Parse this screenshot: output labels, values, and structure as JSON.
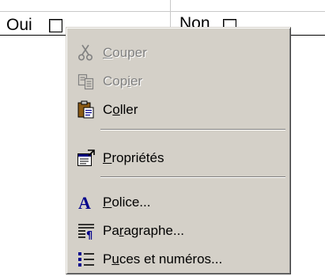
{
  "document": {
    "oui_label": "Oui",
    "non_label": "Non"
  },
  "menu": {
    "items": [
      {
        "label": "Couper",
        "access_key_index": 0,
        "icon": "scissors-icon",
        "enabled": false
      },
      {
        "label": "Copier",
        "access_key_index": 3,
        "icon": "copy-icon",
        "enabled": false
      },
      {
        "label": "Coller",
        "access_key_index": 1,
        "icon": "paste-icon",
        "enabled": true
      },
      {
        "label": "Propriétés",
        "access_key_index": 0,
        "icon": "properties-icon",
        "enabled": true
      },
      {
        "label": "Police...",
        "access_key_index": 0,
        "icon": "font-icon",
        "enabled": true
      },
      {
        "label": "Paragraphe...",
        "access_key_index": 2,
        "icon": "paragraph-icon",
        "enabled": true
      },
      {
        "label": "Puces et numéros...",
        "access_key_index": 1,
        "icon": "bullets-icon",
        "enabled": true
      }
    ]
  },
  "colors": {
    "menu_face": "#d4d0c8",
    "disabled_text": "#808080",
    "font_icon_blue": "#00008b"
  }
}
